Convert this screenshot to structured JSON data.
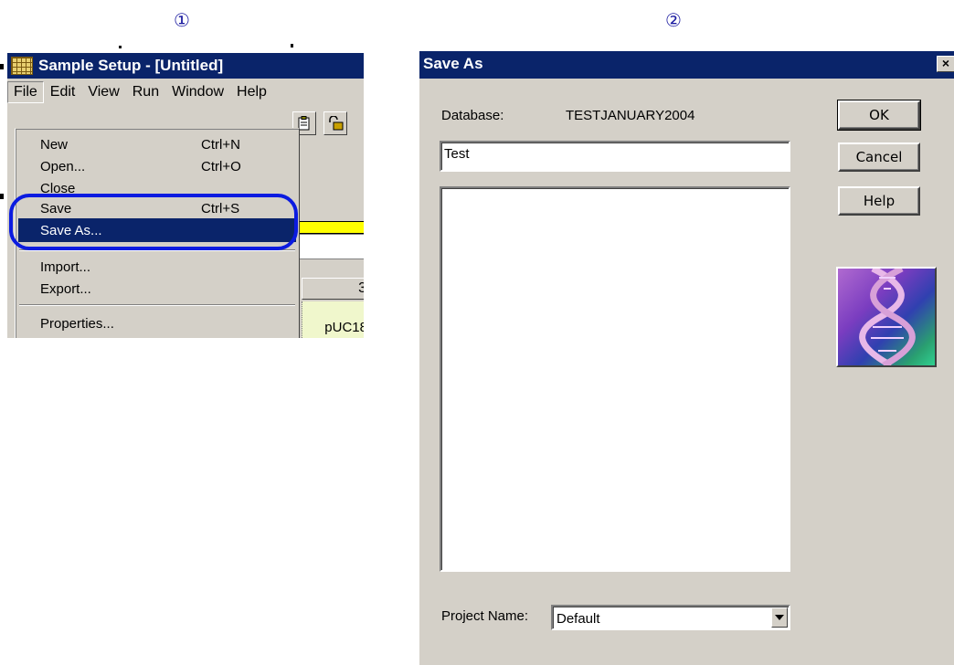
{
  "step_markers": {
    "first": "①",
    "second": "②"
  },
  "panel1": {
    "window_title": "Sample Setup - [Untitled]",
    "menubar": [
      "File",
      "Edit",
      "View",
      "Run",
      "Window",
      "Help"
    ],
    "file_menu": {
      "items": [
        {
          "label": "New",
          "shortcut": "Ctrl+N"
        },
        {
          "label": "Open...",
          "shortcut": "Ctrl+O"
        },
        {
          "label": "Close",
          "shortcut": ""
        },
        {
          "label": "Save",
          "shortcut": "Ctrl+S"
        },
        {
          "label": "Save As...",
          "shortcut": ""
        },
        {
          "label": "Import...",
          "shortcut": ""
        },
        {
          "label": "Export...",
          "shortcut": ""
        },
        {
          "label": "Properties...",
          "shortcut": ""
        }
      ],
      "selected": "Save As..."
    },
    "grid_column_header": "3",
    "grid_cell": "pUC18"
  },
  "panel2": {
    "dialog_title": "Save As",
    "close_glyph": "×",
    "database_label": "Database:",
    "database_value": "TESTJANUARY2004",
    "name_value": "Test",
    "buttons": {
      "ok": "OK",
      "cancel": "Cancel",
      "help": "Help"
    },
    "project_label": "Project Name:",
    "project_value": "Default"
  },
  "colors": {
    "titlebar": "#0a246a",
    "dialog_bg": "#d4d0c8",
    "highlight_oval": "#0b1be0",
    "menu_selection": "#0a246a"
  },
  "icons": [
    "app-grid-icon",
    "clipboard-icon",
    "lock-icon",
    "close-icon",
    "dropdown-arrow-icon",
    "dna-helix-image"
  ]
}
